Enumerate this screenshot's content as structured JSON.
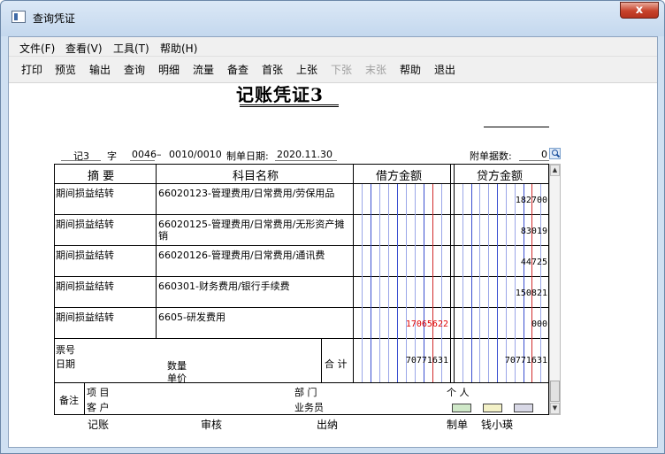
{
  "window": {
    "title": "查询凭证",
    "close": "x"
  },
  "menu": [
    "文件(F)",
    "查看(V)",
    "工具(T)",
    "帮助(H)"
  ],
  "toolbar": [
    {
      "label": "打印",
      "enabled": true
    },
    {
      "label": "预览",
      "enabled": true
    },
    {
      "label": "输出",
      "enabled": true
    },
    {
      "label": "查询",
      "enabled": true
    },
    {
      "label": "明细",
      "enabled": true
    },
    {
      "label": "流量",
      "enabled": true
    },
    {
      "label": "备查",
      "enabled": true
    },
    {
      "label": "首张",
      "enabled": true
    },
    {
      "label": "上张",
      "enabled": true
    },
    {
      "label": "下张",
      "enabled": false
    },
    {
      "label": "末张",
      "enabled": false
    },
    {
      "label": "帮助",
      "enabled": true
    },
    {
      "label": "退出",
      "enabled": true
    }
  ],
  "voucher": {
    "title": "记账凭证3",
    "type": "记3",
    "zi": "字",
    "number": "0046",
    "dash": "–",
    "page": "0010/0010",
    "date_label": "制单日期:",
    "date": "2020.11.30",
    "attach_label": "附单据数:",
    "attach_count": "0"
  },
  "table": {
    "headers": [
      "摘 要",
      "科目名称",
      "借方金额",
      "贷方金额"
    ],
    "rows": [
      {
        "summary": "期间损益结转",
        "account": "66020123-管理费用/日常费用/劳保用品",
        "debit": "",
        "credit": "182700"
      },
      {
        "summary": "期间损益结转",
        "account": "66020125-管理费用/日常费用/无形资产摊",
        "account2": "销",
        "debit": "",
        "credit": "83019"
      },
      {
        "summary": "期间损益结转",
        "account": "66020126-管理费用/日常费用/通讯费",
        "debit": "",
        "credit": "44725"
      },
      {
        "summary": "期间损益结转",
        "account": "660301-财务费用/银行手续费",
        "debit": "",
        "credit": "150821"
      },
      {
        "summary": "期间损益结转",
        "account": "6605-研发费用",
        "debit": "17065622",
        "credit": "000"
      }
    ],
    "totals": {
      "ticket_label": "票号",
      "date_label": "日期",
      "qty_label": "数量",
      "price_label": "单价",
      "sum_label": "合 计",
      "debit": "70771631",
      "credit": "70771631"
    },
    "remarks": {
      "label": "备注",
      "project": "项  目",
      "dept": "部  门",
      "person": "个  人",
      "customer": "客  户",
      "salesman": "业务员"
    }
  },
  "footer": [
    "记账",
    "审核",
    "出纳",
    "制单",
    "钱小瑛"
  ]
}
